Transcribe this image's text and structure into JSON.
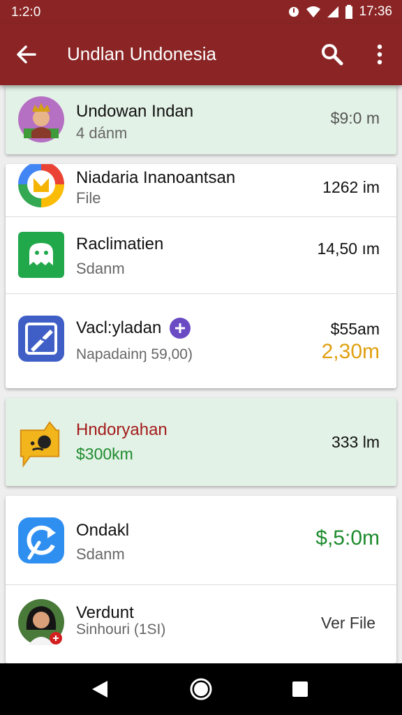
{
  "status_bar": {
    "time_left": "1:2:0",
    "time_right": "17:36"
  },
  "app_bar": {
    "title": "Undlan Undonesia"
  },
  "colors": {
    "primary": "#8b2525",
    "green_text": "#1e8b2e",
    "orange_text": "#e0a010",
    "red_text": "#a31b1b",
    "badge": "#6a4bc4"
  },
  "items": [
    {
      "title": "Undowan Indan",
      "subtitle": "4 dánm",
      "value": "$9:0 m",
      "icon": "avatar-photo-icon"
    },
    {
      "title": "Niadaria Inanoantsan",
      "subtitle": "File",
      "value": "1262 im",
      "icon": "google-drive-style-icon"
    },
    {
      "title": "Raclimatien",
      "subtitle": "Sdanm",
      "value": "14,50 ım",
      "icon": "green-ghost-app-icon"
    },
    {
      "title": "Vacl:yladan",
      "subtitle": "Napadainŋ 59,00)",
      "value": "$55am",
      "value2": "2,30m",
      "icon": "blue-pen-app-icon",
      "badge_icon": "plus-badge-icon"
    },
    {
      "title": "Hndoryahan",
      "subtitle": "$300km",
      "value": "333 lm",
      "icon": "yellow-chat-app-icon"
    },
    {
      "title": "Ondakl",
      "subtitle": "Sdanm",
      "value": "$,5:0m",
      "icon": "blue-refresh-app-icon"
    },
    {
      "title": "Verdunt",
      "subtitle": "Sinhouri (1SI)",
      "value": "Ver File",
      "icon": "woman-avatar-icon"
    }
  ]
}
